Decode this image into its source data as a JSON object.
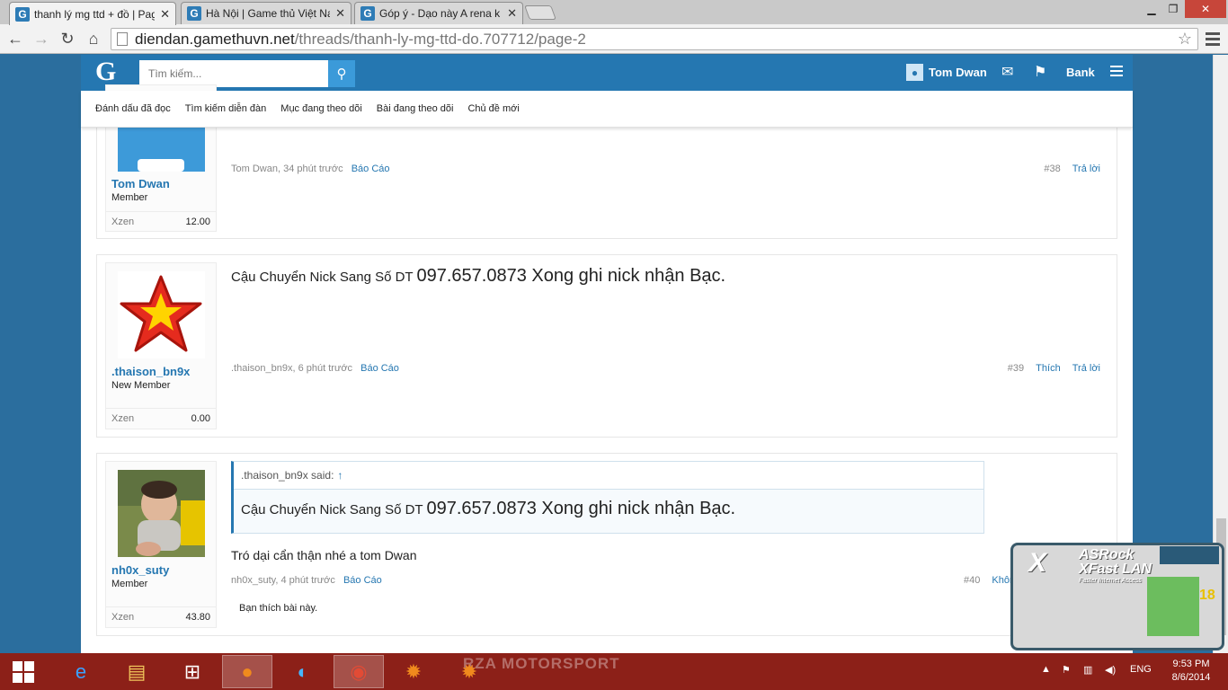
{
  "browser": {
    "tabs": [
      {
        "label": "thanh lý mg ttd + đồ | Pag",
        "active": true
      },
      {
        "label": "Hà Nội | Game thủ Việt Na",
        "active": false
      },
      {
        "label": "Góp ý - Dạo này A rena k",
        "active": false
      }
    ],
    "url_host": "diendan.gamethuvn.net",
    "url_path": "/threads/thanh-ly-mg-ttd-do.707712/page-2"
  },
  "site": {
    "logo": "G",
    "search_placeholder": "Tìm kiếm...",
    "username": "Tom Dwan",
    "bank_label": "Bank",
    "subnav": [
      "Đánh dấu đã đọc",
      "Tìm kiếm diễn đàn",
      "Mục đang theo dõi",
      "Bài đang theo dõi",
      "Chủ đề mới"
    ]
  },
  "posts": [
    {
      "username": "Tom Dwan",
      "user_title": "Member",
      "xzen_label": "Xzen",
      "xzen_value": "12.00",
      "meta_author": "Tom Dwan, 34 phút trước",
      "report": "Báo Cáo",
      "post_number": "#38",
      "reply": "Trả lời"
    },
    {
      "username": ".thaison_bn9x",
      "user_title": "New Member",
      "xzen_label": "Xzen",
      "xzen_value": "0.00",
      "text_prefix": "Cậu Chuyển Nick Sang Số DT ",
      "text_big": "097.657.0873 Xong ghi nick nhận Bạc.",
      "meta_author": ".thaison_bn9x, 6 phút trước",
      "report": "Báo Cáo",
      "post_number": "#39",
      "like": "Thích",
      "reply": "Trả lời"
    },
    {
      "username": "nh0x_suty",
      "user_title": "Member",
      "xzen_label": "Xzen",
      "xzen_value": "43.80",
      "quote_author": ".thaison_bn9x said:",
      "quote_arrow": "↑",
      "quote_prefix": "Cậu Chuyển Nick Sang Số DT ",
      "quote_big": "097.657.0873 Xong ghi nick nhận Bạc.",
      "text": "Tró dại cẩn thận nhé a tom Dwan",
      "meta_author": "nh0x_suty, 4 phút trước",
      "report": "Báo Cáo",
      "post_number": "#40",
      "unlike": "Không th",
      "likes_text": "Bạn thích bài này."
    }
  ],
  "overlay": {
    "brand": "ASRock",
    "product": "XFast LAN",
    "tagline": "Faster Internet Access",
    "count": "18"
  },
  "taskbar": {
    "wallpaper_text": "RZA MOTORSPORT",
    "lang": "ENG",
    "time": "9:53 PM",
    "date": "8/6/2014"
  },
  "colors": {
    "site_blue": "#2577b1",
    "taskbar": "#8c2018",
    "background": "#2b6e9e"
  }
}
